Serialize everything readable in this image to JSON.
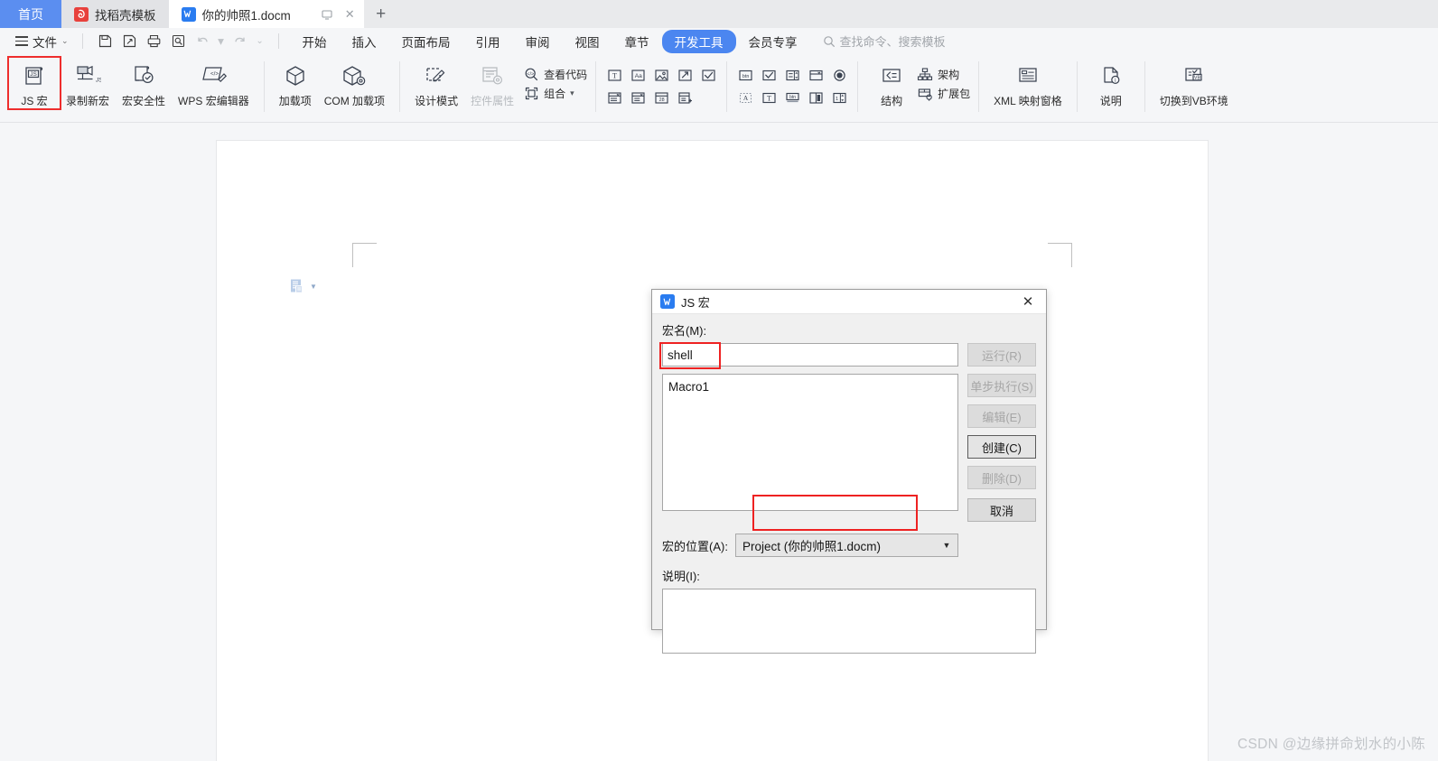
{
  "tabs": {
    "home_label": "首页",
    "template_label": "找稻壳模板",
    "doc_label": "你的帅照1.docm",
    "new_tab_glyph": "+",
    "doc_close_glyph": "✕",
    "doc_window_glyph": "▭"
  },
  "menubar": {
    "file_label": "文件",
    "file_caret": "⌄",
    "quick_access": [
      {
        "name": "save-icon",
        "glyph": "save"
      },
      {
        "name": "save-as-icon",
        "glyph": "saveas"
      },
      {
        "name": "print-icon",
        "glyph": "print"
      },
      {
        "name": "print-preview-icon",
        "glyph": "preview"
      },
      {
        "name": "undo-icon",
        "glyph": "undo"
      },
      {
        "name": "undo-dropdown-icon",
        "glyph": "▾"
      },
      {
        "name": "redo-icon",
        "glyph": "redo"
      },
      {
        "name": "customize-qat-icon",
        "glyph": "⌄"
      }
    ],
    "ribbon_tabs": [
      {
        "label": "开始",
        "active": false
      },
      {
        "label": "插入",
        "active": false
      },
      {
        "label": "页面布局",
        "active": false
      },
      {
        "label": "引用",
        "active": false
      },
      {
        "label": "审阅",
        "active": false
      },
      {
        "label": "视图",
        "active": false
      },
      {
        "label": "章节",
        "active": false
      },
      {
        "label": "开发工具",
        "active": true
      },
      {
        "label": "会员专享",
        "active": false
      }
    ],
    "search_placeholder": "查找命令、搜索模板"
  },
  "ribbon": {
    "group_code": [
      {
        "label": "JS 宏",
        "name": "js-macro-button",
        "highlighted": true
      },
      {
        "label": "录制新宏",
        "name": "record-macro-button"
      },
      {
        "label": "宏安全性",
        "name": "macro-security-button"
      },
      {
        "label": "WPS 宏编辑器",
        "name": "wps-macro-editor-button"
      }
    ],
    "group_addins": [
      {
        "label": "加载项",
        "name": "addins-button"
      },
      {
        "label": "COM 加载项",
        "name": "com-addins-button"
      }
    ],
    "group_controls_left": [
      {
        "label": "设计模式",
        "name": "design-mode-button",
        "disabled": false
      },
      {
        "label": "控件属性",
        "name": "control-properties-button",
        "disabled": true
      }
    ],
    "group_controls_links": [
      {
        "label": "查看代码",
        "name": "view-code-button",
        "disabled": false
      },
      {
        "label": "组合",
        "name": "group-button",
        "disabled": false,
        "caret": "▾"
      }
    ],
    "group_xml": [
      {
        "label": "结构",
        "name": "structure-button"
      },
      {
        "label": "架构",
        "name": "schema-button"
      },
      {
        "label": "扩展包",
        "name": "expansion-pack-button"
      },
      {
        "label": "XML 映射窗格",
        "name": "xml-mapping-pane-button"
      },
      {
        "label": "说明",
        "name": "description-button"
      },
      {
        "label": "切换到VB环境",
        "name": "switch-to-vb-button"
      }
    ]
  },
  "dialog": {
    "title": "JS 宏",
    "close_glyph": "✕",
    "macro_name_label": "宏名(M):",
    "macro_name_value": "shell",
    "macro_list": [
      "Macro1"
    ],
    "buttons": [
      {
        "label": "运行(R)",
        "name": "run-button",
        "disabled": true
      },
      {
        "label": "单步执行(S)",
        "name": "step-button",
        "disabled": true
      },
      {
        "label": "编辑(E)",
        "name": "edit-button",
        "disabled": true
      },
      {
        "label": "创建(C)",
        "name": "create-button",
        "disabled": false,
        "strong": true
      },
      {
        "label": "删除(D)",
        "name": "delete-button",
        "disabled": true
      },
      {
        "label": "取消",
        "name": "cancel-button",
        "disabled": false
      }
    ],
    "location_label": "宏的位置(A):",
    "location_value": "Project (你的帅照1.docm)",
    "location_arrow": "▼",
    "description_label": "说明(I):",
    "description_value": ""
  },
  "watermark": "CSDN @边缘拼命划水的小陈",
  "colors": {
    "accent": "#4b86f0",
    "home_tab": "#5b8ef0",
    "annotation": "#ee2222",
    "dialog_bg": "#f0f0f0",
    "app_bg": "#f5f6f8"
  }
}
